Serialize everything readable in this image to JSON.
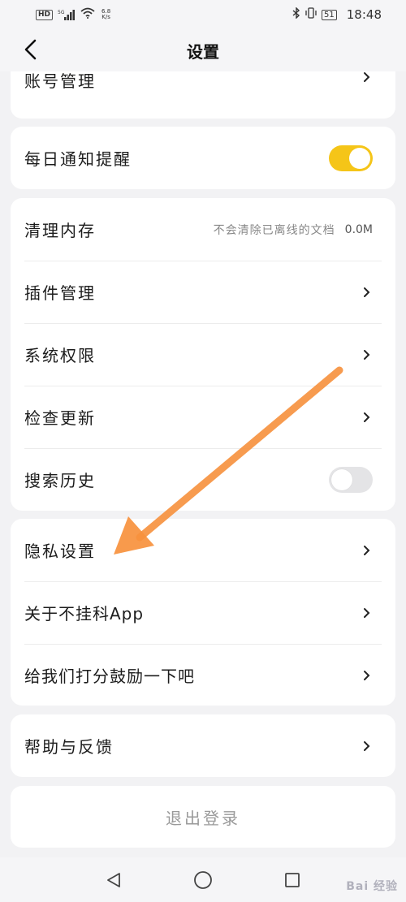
{
  "status_bar": {
    "hd_badge": "HD",
    "signal_label": "5G",
    "net_speed_value": "6.8",
    "net_speed_unit": "K/s",
    "battery": "51",
    "time": "18:48"
  },
  "nav": {
    "title": "设置"
  },
  "sections": {
    "account": {
      "label": "账号管理"
    },
    "daily_notify": {
      "label": "每日通知提醒",
      "enabled": true
    },
    "clear_cache": {
      "label": "清理内存",
      "hint": "不会清除已离线的文档",
      "value": "0.0M"
    },
    "plugins": {
      "label": "插件管理"
    },
    "permissions": {
      "label": "系统权限"
    },
    "check_update": {
      "label": "检查更新"
    },
    "search_history": {
      "label": "搜索历史",
      "enabled": false
    },
    "privacy": {
      "label": "隐私设置"
    },
    "about": {
      "label": "关于不挂科App"
    },
    "rate_us": {
      "label": "给我们打分鼓励一下吧"
    },
    "help": {
      "label": "帮助与反馈"
    },
    "logout": {
      "label": "退出登录"
    }
  },
  "watermark": "Bai 经验",
  "colors": {
    "accent": "#f5c518",
    "annotation_arrow": "#f7913d"
  }
}
